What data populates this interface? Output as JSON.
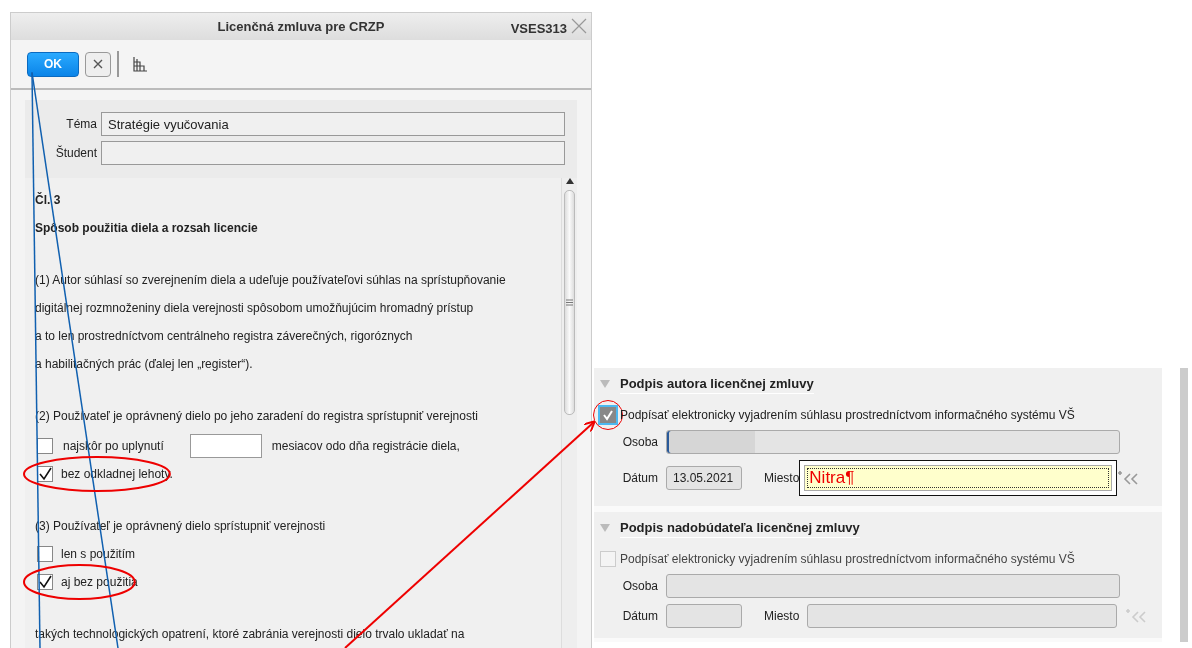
{
  "dialog": {
    "title": "Licenčná zmluva pre CRZP",
    "code": "VSES313",
    "ok_button": "OK",
    "fields": [
      {
        "label": "Téma",
        "value": "Stratégie vyučovania"
      },
      {
        "label": "Študent"
      }
    ],
    "article": {
      "number": "Čl. 3",
      "heading": "Spôsob použitia diela a rozsah licencie",
      "blocks": [
        {
          "kind": "paragraph",
          "lines": [
            "(1) Autor súhlasí so zverejnením diela a udeľuje používateľovi súhlas na sprístupňovanie",
            "digitálnej rozmnoženiny diela verejnosti spôsobom umožňujúcim hromadný prístup",
            "a to len prostredníctvom centrálneho registra záverečných, rigoróznych",
            "a habilitačných prác (ďalej len „register“)."
          ]
        },
        {
          "kind": "paragraph",
          "lines": [
            "(2) Používateľ je oprávnený dielo po jeho zaradení do registra sprístupniť verejnosti"
          ]
        },
        {
          "kind": "months_option",
          "label": "najskôr po uplynutí",
          "suffix": "mesiacov odo dňa registrácie diela,",
          "checked": false,
          "circled": false
        },
        {
          "kind": "option",
          "label": "bez odkladnej lehoty.",
          "checked": true,
          "circled": true
        },
        {
          "kind": "paragraph",
          "lines": [
            "(3) Používateľ je oprávnený dielo sprístupniť verejnosti"
          ]
        },
        {
          "kind": "option",
          "label": "len s použitím",
          "checked": false,
          "circled": false
        },
        {
          "kind": "option",
          "label": "aj bez použitia",
          "checked": true,
          "circled": true
        },
        {
          "kind": "paragraph",
          "lines": [
            "takých technologických opatrení, ktoré zabránia verejnosti dielo trvalo ukladať na"
          ]
        }
      ]
    }
  },
  "signatures": [
    {
      "title": "Podpis autora licenčnej zmluvy",
      "sign_label": "Podpísať elektronicky vyjadrením súhlasu prostredníctvom informačného systému VŠ",
      "checked": true,
      "disabled": false,
      "circled": true,
      "person_label": "Osoba",
      "date_label": "Dátum",
      "date": "13.05.2021",
      "place_label": "Miesto",
      "place": "Nitra¶"
    },
    {
      "title": "Podpis nadobúdateľa licenčnej zmluvy",
      "sign_label": "Podpísať elektronicky vyjadrením súhlasu prostredníctvom informačného systému VŠ",
      "checked": false,
      "disabled": true,
      "circled": false,
      "person_label": "Osoba",
      "date_label": "Dátum",
      "place_label": "Miesto"
    }
  ]
}
